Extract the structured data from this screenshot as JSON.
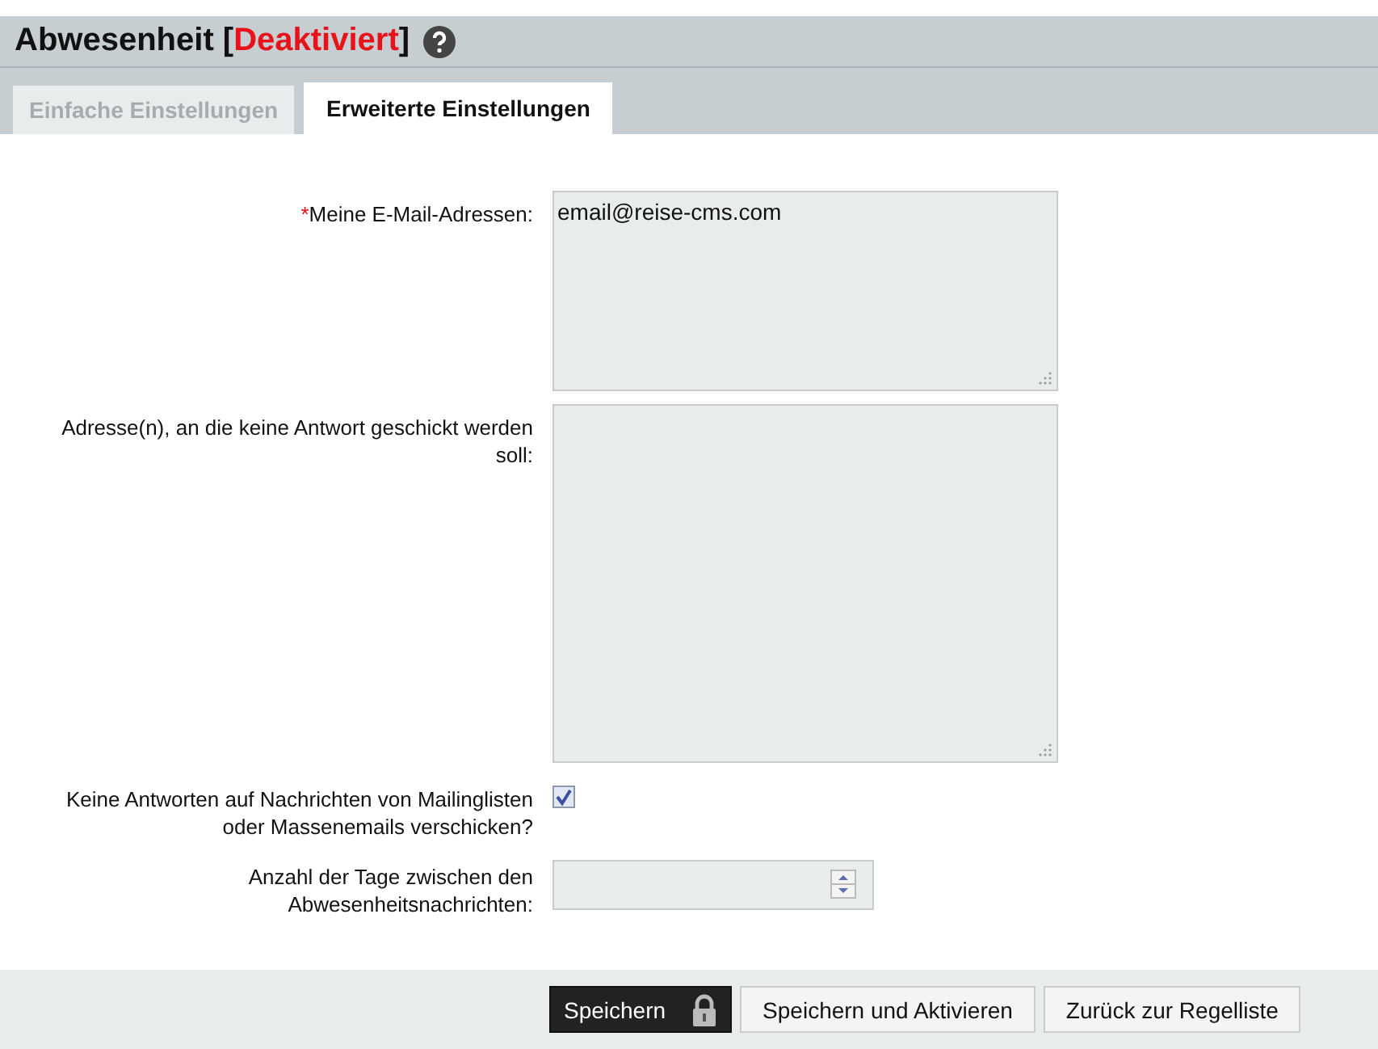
{
  "header": {
    "title": "Abwesenheit [",
    "status": "Deaktiviert",
    "title_end": "]"
  },
  "tabs": [
    {
      "label": "Einfache Einstellungen",
      "selected": false
    },
    {
      "label": "Erweiterte Einstellungen",
      "selected": true
    }
  ],
  "fields": [
    {
      "kind": "textarea",
      "label": "Meine E-Mail-Adressen:",
      "required_mark": "*",
      "value": "email@reise-cms.com"
    },
    {
      "kind": "textarea",
      "label": "Adresse(n), an die keine Antwort geschickt werden soll:"
    },
    {
      "kind": "checkbox",
      "label": "Keine Antworten auf Nachrichten von Mailinglisten oder Massenemails verschicken?",
      "checked": true
    },
    {
      "kind": "number",
      "label": "Anzahl der Tage zwischen den Abwesenheitsnachrichten:"
    }
  ],
  "buttons": [
    {
      "label": "Speichern",
      "kind": "primary"
    },
    {
      "label": "Speichern und Aktivieren",
      "kind": "default"
    },
    {
      "label": "Zurück zur Regelliste",
      "kind": "default"
    }
  ]
}
